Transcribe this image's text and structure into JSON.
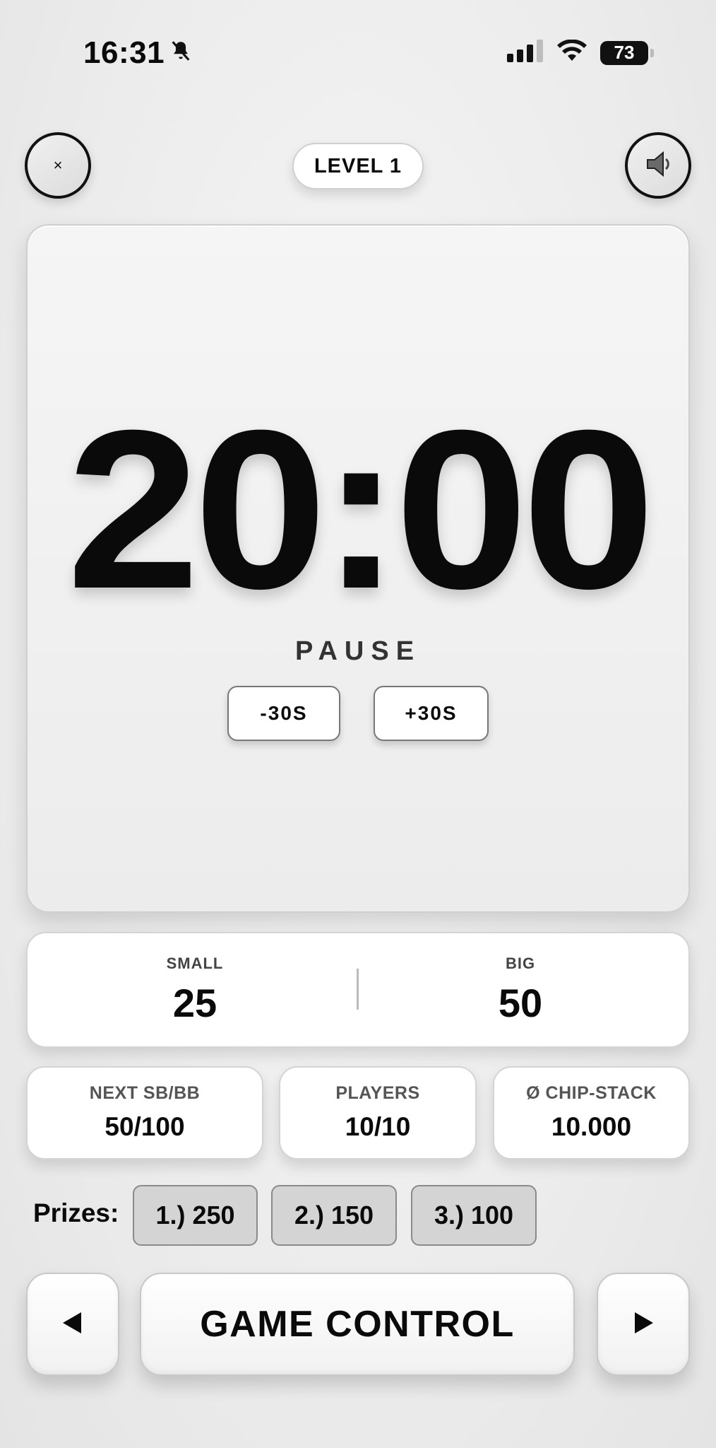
{
  "status_bar": {
    "time": "16:31",
    "battery": "73"
  },
  "header": {
    "close_label": "×",
    "level_label": "LEVEL 1"
  },
  "timer": {
    "value": "20:00",
    "pause_label": "PAUSE",
    "minus_label": "-30S",
    "plus_label": "+30S"
  },
  "blinds": {
    "small_label": "SMALL",
    "small_value": "25",
    "big_label": "BIG",
    "big_value": "50"
  },
  "info": [
    {
      "label": "NEXT SB/BB",
      "value": "50/100"
    },
    {
      "label": "PLAYERS",
      "value": "10/10"
    },
    {
      "label": "Ø CHIP-STACK",
      "value": "10.000"
    }
  ],
  "prizes": {
    "label": "Prizes:",
    "items": [
      "1.) 250",
      "2.) 150",
      "3.) 100"
    ]
  },
  "controls": {
    "game_control_label": "GAME CONTROL"
  },
  "colors": {
    "text": "#0a0a0a",
    "background": "#ececec",
    "card": "#ffffff",
    "prize_chip": "#d4d4d4"
  }
}
